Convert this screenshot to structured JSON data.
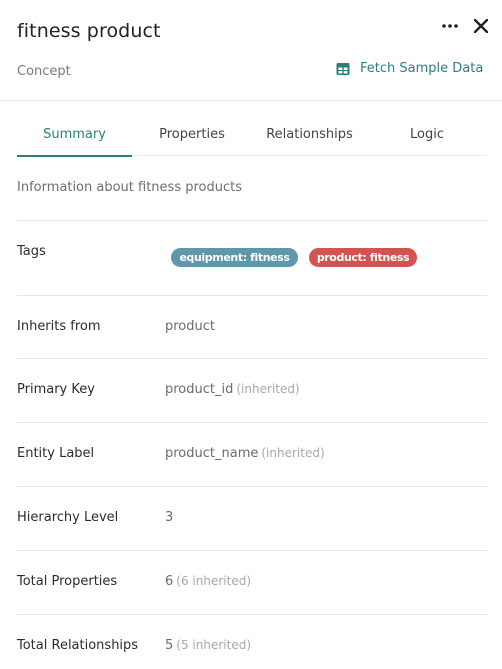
{
  "header": {
    "title": "fitness product",
    "subtitle": "Concept",
    "fetch_label": "Fetch Sample Data",
    "more_icon": "more-horizontal-icon",
    "close_icon": "close-icon",
    "fetch_icon": "table-icon"
  },
  "tabs": [
    {
      "label": "Summary",
      "active": true
    },
    {
      "label": "Properties",
      "active": false
    },
    {
      "label": "Relationships",
      "active": false
    },
    {
      "label": "Logic",
      "active": false
    }
  ],
  "summary": {
    "description": "Information about fitness products",
    "tags_label": "Tags",
    "tags": [
      {
        "label": "equipment: fitness",
        "color": "#5f97ab"
      },
      {
        "label": "product: fitness",
        "color": "#d4524f"
      }
    ],
    "rows": [
      {
        "label": "Inherits from",
        "value": "product",
        "note": ""
      },
      {
        "label": "Primary Key",
        "value": "product_id",
        "note": "(inherited)"
      },
      {
        "label": "Entity Label",
        "value": "product_name",
        "note": "(inherited)"
      },
      {
        "label": "Hierarchy Level",
        "value": "3",
        "note": ""
      },
      {
        "label": "Total Properties",
        "value": "6",
        "note": "(6 inherited)"
      },
      {
        "label": "Total Relationships",
        "value": "5",
        "note": "(5 inherited)"
      }
    ]
  },
  "colors": {
    "accent": "#2b7f79",
    "tag_blue": "#5f97ab",
    "tag_red": "#d4524f"
  }
}
